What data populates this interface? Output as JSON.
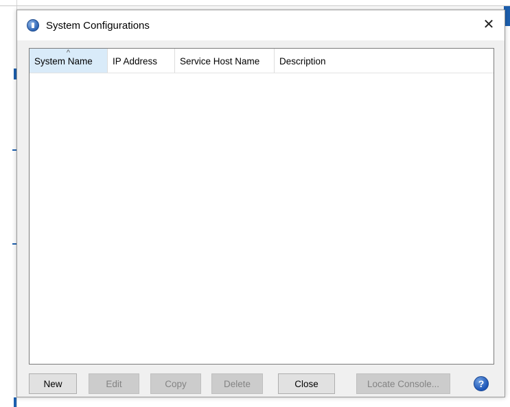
{
  "dialog": {
    "title": "System Configurations",
    "close_glyph": "✕",
    "icon": "app-info-icon"
  },
  "table": {
    "columns": [
      "System Name",
      "IP Address",
      "Service Host Name",
      "Description"
    ],
    "sorted_column": "System Name",
    "sort_direction": "ascending",
    "sort_glyph": "^",
    "rows": []
  },
  "buttons": {
    "new": {
      "label": "New",
      "enabled": true
    },
    "edit": {
      "label": "Edit",
      "enabled": false
    },
    "copy": {
      "label": "Copy",
      "enabled": false
    },
    "delete": {
      "label": "Delete",
      "enabled": false
    },
    "close": {
      "label": "Close",
      "enabled": true
    },
    "locate_console": {
      "label": "Locate Console...",
      "enabled": false
    },
    "help_glyph": "?"
  },
  "colors": {
    "accent": "#1c5fae",
    "sorted_header": "#d9ebf9",
    "dialog_bg": "#f0f0f0"
  }
}
